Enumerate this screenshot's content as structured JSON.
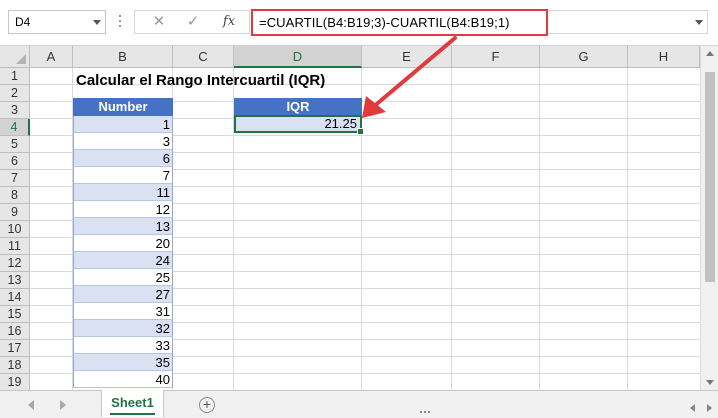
{
  "formula_bar": {
    "name_box": "D4",
    "cancel_glyph": "✕",
    "enter_glyph": "✓",
    "function_glyph": "fx",
    "formula": "=CUARTIL(B4:B19;3)-CUARTIL(B4:B19;1)"
  },
  "columns": [
    "A",
    "B",
    "C",
    "D",
    "E",
    "F",
    "G",
    "H"
  ],
  "rows": [
    "1",
    "2",
    "3",
    "4",
    "5",
    "6",
    "7",
    "8",
    "9",
    "10",
    "11",
    "12",
    "13",
    "14",
    "15",
    "16",
    "17",
    "18",
    "19"
  ],
  "sheet": {
    "title": "Calcular el Rango Intercuartil (IQR)",
    "number_header": "Number",
    "numbers": [
      "1",
      "3",
      "6",
      "7",
      "11",
      "12",
      "13",
      "20",
      "24",
      "25",
      "27",
      "31",
      "32",
      "33",
      "35",
      "40"
    ],
    "iqr_header": "IQR",
    "iqr_value": "21.25"
  },
  "tabs": {
    "active": "Sheet1",
    "add_glyph": "+"
  },
  "colors": {
    "header_fill": "#4472c4",
    "band_fill": "#d9e1f2",
    "selection": "#217346",
    "highlight": "#e0393e"
  },
  "icons": [
    "chevron-down-icon",
    "cancel-icon",
    "enter-icon",
    "function-icon",
    "add-sheet-icon",
    "arrow-annotation-icon"
  ]
}
